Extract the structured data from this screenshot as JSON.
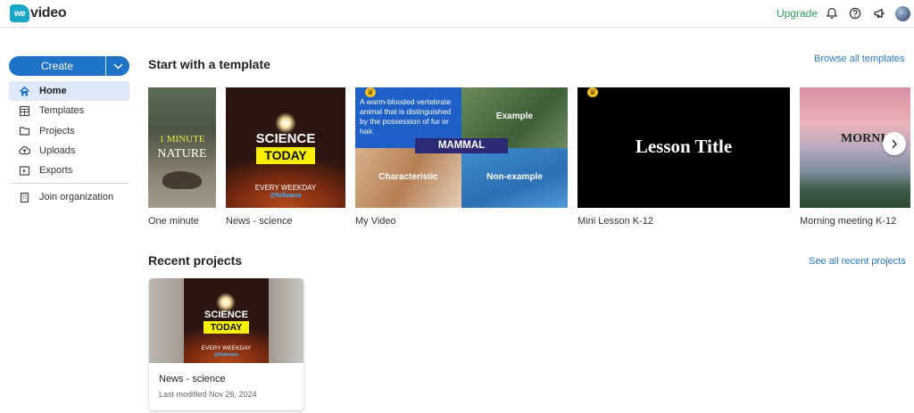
{
  "app": {
    "logo_mark": "we",
    "logo_word": "video",
    "upgrade_label": "Upgrade",
    "brand_color": "#1f73c6",
    "upgrade_color": "#2e9d4e"
  },
  "topbar_icons": [
    "bell-icon",
    "help-icon",
    "megaphone-icon",
    "avatar"
  ],
  "sidebar": {
    "create_label": "Create",
    "items": [
      {
        "label": "Home",
        "icon": "home-icon",
        "active": true
      },
      {
        "label": "Templates",
        "icon": "templates-icon"
      },
      {
        "label": "Projects",
        "icon": "folder-icon"
      },
      {
        "label": "Uploads",
        "icon": "cloud-upload-icon"
      },
      {
        "label": "Exports",
        "icon": "export-icon"
      }
    ],
    "org_item": {
      "label": "Join organization",
      "icon": "building-icon"
    }
  },
  "templates_section": {
    "title": "Start with a template",
    "link": "Browse all templates",
    "tiles": [
      {
        "label": "One minute",
        "art": {
          "line1": "1 MINUTE",
          "line2": "NATURE"
        }
      },
      {
        "label": "News - science",
        "art": {
          "line1": "SCIENCE",
          "line2": "TODAY",
          "line3": "EVERY WEEKDAY",
          "line4": "@followus"
        }
      },
      {
        "label": "My Video",
        "art": {
          "definition": "A warm-blooded vertebrate animal that is distinguished by the possession of fur or hair.",
          "example": "Example",
          "word": "MAMMAL",
          "characteristic": "Characteristic",
          "non_example": "Non-example"
        }
      },
      {
        "label": "Mini Lesson K-12",
        "art": {
          "title": "Lesson Title"
        }
      },
      {
        "label": "Morning meeting K-12",
        "art": {
          "title": "MORNI"
        }
      }
    ]
  },
  "recent_section": {
    "title": "Recent projects",
    "link": "See all recent projects",
    "projects": [
      {
        "title": "News - science",
        "modified": "Last modified Nov 26, 2024",
        "art": {
          "line1": "SCIENCE",
          "line2": "TODAY",
          "line3": "EVERY WEEKDAY",
          "line4": "@followus"
        }
      }
    ]
  }
}
